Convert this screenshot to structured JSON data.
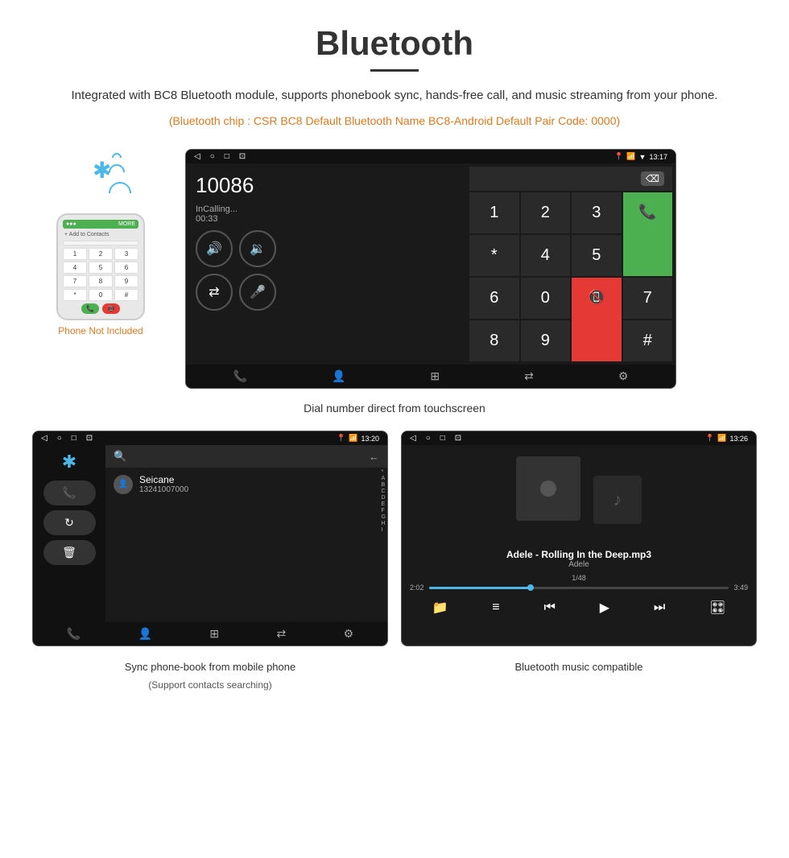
{
  "header": {
    "title": "Bluetooth",
    "description": "Integrated with BC8 Bluetooth module, supports phonebook sync, hands-free call, and music streaming from your phone.",
    "orange_note": "(Bluetooth chip : CSR BC8    Default Bluetooth Name BC8-Android    Default Pair Code: 0000)"
  },
  "phone_visual": {
    "not_included_label": "Phone Not Included",
    "keypad": [
      "1",
      "2",
      "3",
      "4",
      "5",
      "6",
      "7",
      "8",
      "9",
      "*",
      "0",
      "#"
    ]
  },
  "dial_screen": {
    "status_time": "13:17",
    "dialed_number": "10086",
    "calling_label": "InCalling...",
    "call_duration": "00:33",
    "nav_icons": [
      "◁",
      "○",
      "□",
      "⊡"
    ],
    "keypad_keys": [
      "1",
      "2",
      "3",
      "*",
      "4",
      "5",
      "6",
      "0",
      "7",
      "8",
      "9",
      "#"
    ],
    "caption": "Dial number direct from touchscreen"
  },
  "phonebook_screen": {
    "status_time": "13:20",
    "contact_name": "Seicane",
    "contact_number": "13241007000",
    "alphabet": [
      "*",
      "A",
      "B",
      "C",
      "D",
      "E",
      "F",
      "G",
      "H",
      "I"
    ],
    "caption": "Sync phone-book from mobile phone",
    "caption_sub": "(Support contacts searching)"
  },
  "music_screen": {
    "status_time": "13:26",
    "track_name": "Adele - Rolling In the Deep.mp3",
    "artist": "Adele",
    "track_count": "1/48",
    "time_current": "2:02",
    "time_total": "3:49",
    "caption": "Bluetooth music compatible"
  },
  "icons": {
    "bluetooth": "✱",
    "phone": "📞",
    "contacts": "👤",
    "keypad_grid": "⊞",
    "settings": "⚙",
    "transfer": "⇄",
    "mic": "🎤",
    "vol_up": "🔊",
    "vol_down": "🔉",
    "shuffle": "⇌",
    "search": "🔍",
    "folder": "📁",
    "list": "≡",
    "skip_back": "⏮",
    "play": "▶",
    "skip_fwd": "⏭",
    "equalizer": "🎛",
    "back_arrow": "←",
    "delete": "⌫"
  }
}
